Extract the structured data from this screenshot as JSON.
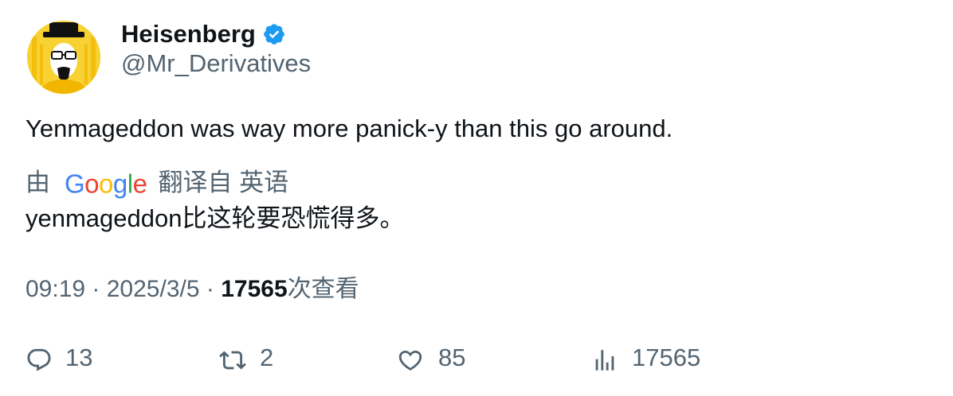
{
  "author": {
    "display_name": "Heisenberg",
    "handle": "@Mr_Derivatives",
    "verified_color": "#1d9bf0"
  },
  "tweet": {
    "text": "Yenmageddon was way more panick-y than this go around."
  },
  "translation": {
    "by_label": "由",
    "provider": "Google",
    "from_label": "翻译自 英语",
    "text": "yenmageddon比这轮要恐慌得多。"
  },
  "meta": {
    "time": "09:19",
    "separator": " · ",
    "date": "2025/3/5",
    "views_count": "17565",
    "views_label": "次查看"
  },
  "actions": {
    "reply_count": "13",
    "retweet_count": "2",
    "like_count": "85",
    "views_count": "17565"
  },
  "icons": {
    "avatar": "heisenberg-avatar",
    "verified": "verified-badge-icon",
    "reply": "reply-icon",
    "retweet": "retweet-icon",
    "like": "heart-icon",
    "views": "analytics-icon"
  }
}
